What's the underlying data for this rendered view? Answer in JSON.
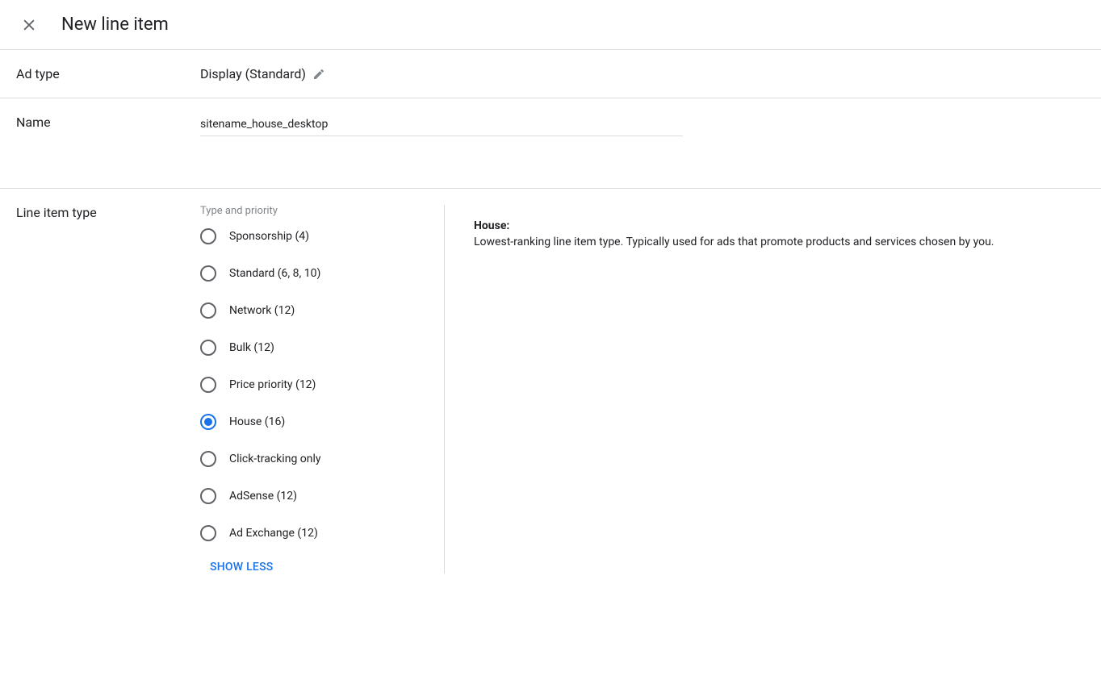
{
  "header": {
    "title": "New line item"
  },
  "ad_type": {
    "label": "Ad type",
    "value": "Display (Standard)"
  },
  "name": {
    "label": "Name",
    "value": "sitename_house_desktop"
  },
  "line_item_type": {
    "label": "Line item type",
    "type_priority_label": "Type and priority",
    "options": [
      {
        "label": "Sponsorship (4)",
        "selected": false
      },
      {
        "label": "Standard (6, 8, 10)",
        "selected": false
      },
      {
        "label": "Network (12)",
        "selected": false
      },
      {
        "label": "Bulk (12)",
        "selected": false
      },
      {
        "label": "Price priority (12)",
        "selected": false
      },
      {
        "label": "House (16)",
        "selected": true
      },
      {
        "label": "Click-tracking only",
        "selected": false
      },
      {
        "label": "AdSense (12)",
        "selected": false
      },
      {
        "label": "Ad Exchange (12)",
        "selected": false
      }
    ],
    "show_less_label": "SHOW LESS",
    "selected_description": {
      "title": "House:",
      "text": "Lowest-ranking line item type. Typically used for ads that promote products and services chosen by you."
    }
  }
}
